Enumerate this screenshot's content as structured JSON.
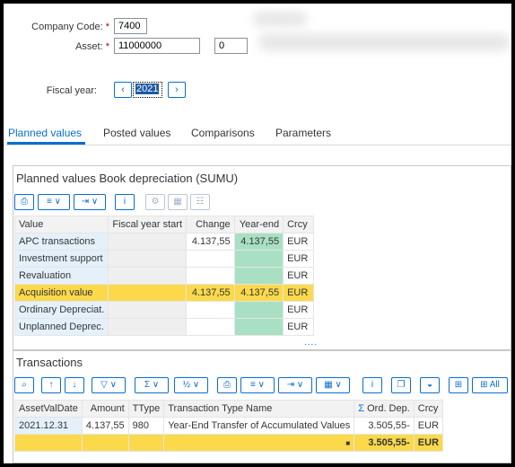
{
  "header": {
    "company_code_label": "Company Code:",
    "company_code_value": "7400",
    "asset_label": "Asset:",
    "asset_value": "11000000",
    "asset_sub_value": "0",
    "fiscal_year_label": "Fiscal year:",
    "fiscal_year_value": "2021",
    "required_mark": "*"
  },
  "tabs": [
    {
      "label": "Planned values",
      "active": true
    },
    {
      "label": "Posted values",
      "active": false
    },
    {
      "label": "Comparisons",
      "active": false
    },
    {
      "label": "Parameters",
      "active": false
    }
  ],
  "planned": {
    "title": "Planned values Book depreciation (SUMU)",
    "columns": [
      "Value",
      "Fiscal year start",
      "Change",
      "Year-end",
      "Crcy"
    ],
    "rows": [
      {
        "value": "APC transactions",
        "fys": "",
        "change": "4.137,55",
        "ye": "4.137,55",
        "crcy": "EUR"
      },
      {
        "value": "Investment support",
        "fys": "",
        "change": "",
        "ye": "",
        "crcy": "EUR"
      },
      {
        "value": "Revaluation",
        "fys": "",
        "change": "",
        "ye": "",
        "crcy": "EUR"
      },
      {
        "value": "Acquisition value",
        "fys": "",
        "change": "4.137,55",
        "ye": "4.137,55",
        "crcy": "EUR"
      },
      {
        "value": "Ordinary Depreciat.",
        "fys": "",
        "change": "",
        "ye": "",
        "crcy": "EUR"
      },
      {
        "value": "Unplanned Deprec.",
        "fys": "",
        "change": "",
        "ye": "",
        "crcy": "EUR"
      }
    ],
    "more": "...."
  },
  "transactions": {
    "title": "Transactions",
    "all_label": "All",
    "columns": [
      "AssetValDate",
      "Amount",
      "TType",
      "Transaction Type Name",
      "Ord. Dep.",
      "Crcy"
    ],
    "rows": [
      {
        "date": "2021.12.31",
        "amount": "4.137,55",
        "ttype": "980",
        "name": "Year-End Transfer of Accumulated Values",
        "orddep": "3.505,55-",
        "crcy": "EUR"
      }
    ],
    "total": {
      "marker": "■",
      "orddep": "3.505,55-",
      "crcy": "EUR"
    }
  },
  "colors": {
    "accent": "#0a6ed1",
    "highlight": "#fbd94b",
    "green": "#a9e0c3"
  }
}
